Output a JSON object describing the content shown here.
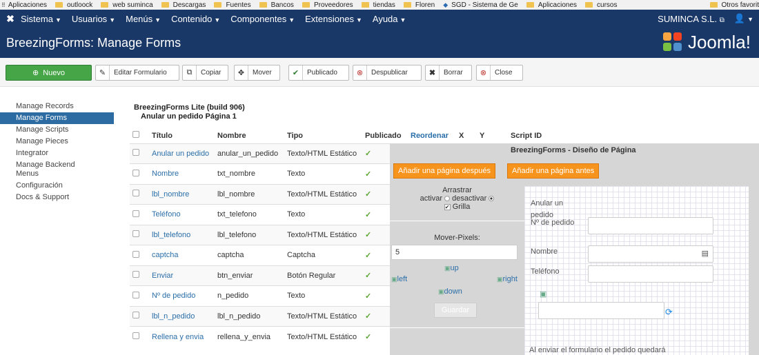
{
  "bookmarks": {
    "items": [
      "Aplicaciones",
      "outloock",
      "web suminca",
      "Descargas",
      "Fuentes",
      "Bancos",
      "Proveedores",
      "tiendas",
      "Floren",
      "SGD - Sistema de Ge",
      "Aplicaciones",
      "cursos"
    ],
    "other": "Otros favorit"
  },
  "topnav": {
    "menus": [
      "Sistema",
      "Usuarios",
      "Menús",
      "Contenido",
      "Componentes",
      "Extensiones",
      "Ayuda"
    ],
    "site": "SUMINCA S.L."
  },
  "header": {
    "title": "BreezingForms: Manage Forms",
    "brand": "Joomla!"
  },
  "toolbar": {
    "new": "Nuevo",
    "buttons": [
      "Editar Formulario",
      "Copiar",
      "Mover",
      "Publicado",
      "Despublicar",
      "Borrar",
      "Close"
    ]
  },
  "sidebar": {
    "items": [
      "Manage Records",
      "Manage Forms",
      "Manage Scripts",
      "Manage Pieces",
      "Integrator",
      "Manage Backend Menus",
      "Configuración",
      "Docs & Support"
    ],
    "active_index": 1
  },
  "main": {
    "build": "BreezingForms Lite (build 906)",
    "subtitle": "Anular un pedido Página 1",
    "columns": [
      "Título",
      "Nombre",
      "Tipo",
      "Publicado",
      "Reordenar",
      "X",
      "Y",
      "Script ID"
    ],
    "rows": [
      {
        "title": "Anular un pedido",
        "name": "anular_un_pedido",
        "type": "Texto/HTML Estático"
      },
      {
        "title": "Nombre",
        "name": "txt_nombre",
        "type": "Texto"
      },
      {
        "title": "lbl_nombre",
        "name": "lbl_nombre",
        "type": "Texto/HTML Estático"
      },
      {
        "title": "Teléfono",
        "name": "txt_telefono",
        "type": "Texto"
      },
      {
        "title": "lbl_telefono",
        "name": "lbl_telefono",
        "type": "Texto/HTML Estático"
      },
      {
        "title": "captcha",
        "name": "captcha",
        "type": "Captcha"
      },
      {
        "title": "Enviar",
        "name": "btn_enviar",
        "type": "Botón Regular"
      },
      {
        "title": "Nº de pedido",
        "name": "n_pedido",
        "type": "Texto"
      },
      {
        "title": "lbl_n_pedido",
        "name": "lbl_n_pedido",
        "type": "Texto/HTML Estático"
      },
      {
        "title": "Rellena y envia",
        "name": "rellena_y_envia",
        "type": "Texto/HTML Estático"
      }
    ]
  },
  "designer": {
    "title": "BreezingForms - Diseño de Página",
    "add_after": "Añadir una página después",
    "add_before": "Añadir una página antes",
    "drag_label": "Arrastrar",
    "activate": "activar",
    "deactivate": "desactivar",
    "grid": "Grilla",
    "move_pixels": "Mover-Pixels:",
    "move_value": "5",
    "up": "up",
    "left": "left",
    "right": "right",
    "down": "down",
    "save": "Guardar",
    "canvas": {
      "heading_line1": "Anular un",
      "heading_line2": "pedido",
      "label_order": "Nº de pedido",
      "label_name": "Nombre",
      "label_phone": "Teléfono",
      "footer_text": "Al enviar el formulario el pedido quedará"
    }
  }
}
